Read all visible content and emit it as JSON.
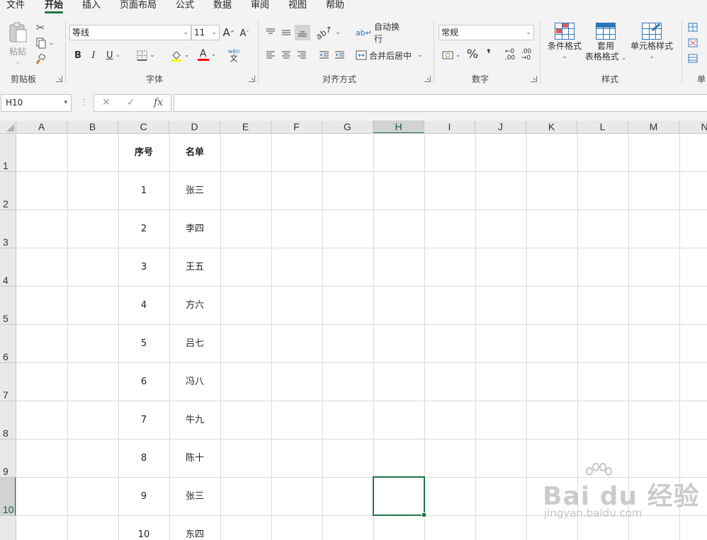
{
  "ribbon": {
    "tabs": [
      "文件",
      "开始",
      "插入",
      "页面布局",
      "公式",
      "数据",
      "审阅",
      "视图",
      "帮助"
    ],
    "active_tab": "开始",
    "groups": {
      "clipboard": "剪贴板",
      "font": "字体",
      "alignment": "对齐方式",
      "number": "数字",
      "styles": "样式",
      "cells": "单"
    },
    "paste_label": "粘贴",
    "font_name": "等线",
    "font_size": "11",
    "bold": "B",
    "italic": "I",
    "underline": "U",
    "wrap_text": "自动换行",
    "merge_center": "合并后居中",
    "number_format": "常规",
    "percent": "%",
    "comma": "❜",
    "conditional_format": "条件格式",
    "table_format_line1": "套用",
    "table_format_line2": "表格格式",
    "cell_styles": "单元格样式",
    "grow_font": "A",
    "shrink_font": "A",
    "phonetic_top": "wén",
    "phonetic_bottom": "文",
    "font_color_letter": "A"
  },
  "formula_bar": {
    "name_box": "H10",
    "cancel": "✕",
    "enter": "✓",
    "fx": "fx",
    "formula": ""
  },
  "sheet": {
    "columns": [
      "A",
      "B",
      "C",
      "D",
      "E",
      "F",
      "G",
      "H",
      "I",
      "J",
      "K",
      "L",
      "M",
      "N"
    ],
    "rows": [
      "1",
      "2",
      "3",
      "4",
      "5",
      "6",
      "7",
      "8",
      "9",
      "10"
    ],
    "selected_cell": "H10",
    "header": {
      "index": "序号",
      "name": "名单"
    },
    "data": [
      {
        "index": "1",
        "name": "张三"
      },
      {
        "index": "2",
        "name": "李四"
      },
      {
        "index": "3",
        "name": "王五"
      },
      {
        "index": "4",
        "name": "方六"
      },
      {
        "index": "5",
        "name": "吕七"
      },
      {
        "index": "6",
        "name": "冯八"
      },
      {
        "index": "7",
        "name": "牛九"
      },
      {
        "index": "8",
        "name": "陈十"
      },
      {
        "index": "9",
        "name": "张三"
      },
      {
        "index": "10",
        "name": "东四"
      }
    ]
  },
  "watermark": {
    "brand": "Bai du 经验",
    "url": "jingyan.baidu.com"
  }
}
